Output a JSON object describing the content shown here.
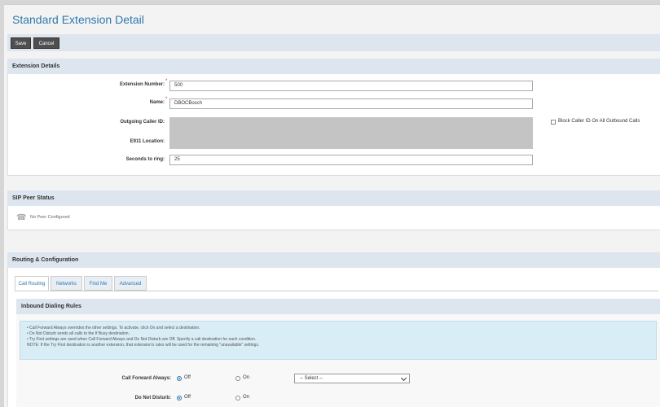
{
  "page": {
    "title": "Standard Extension Detail"
  },
  "toolbar": {
    "save_label": "Save",
    "cancel_label": "Cancel"
  },
  "extension_details": {
    "header": "Extension Details",
    "extension_number_label": "Extension Number:",
    "extension_number_value": "500",
    "name_label": "Name:",
    "name_value": "DBOCBosch",
    "outgoing_caller_id_label": "Outgoing Caller ID:",
    "e911_location_label": "E911 Location:",
    "seconds_to_ring_label": "Seconds to ring:",
    "seconds_to_ring_value": "25",
    "block_caller_id_label": "Block Caller ID On All Outbound Calls"
  },
  "sip_peer": {
    "header": "SIP Peer Status",
    "status_text": "No Peer Configured"
  },
  "routing": {
    "header": "Routing & Configuration",
    "tabs": [
      {
        "label": "Call Routing"
      },
      {
        "label": "Networks"
      },
      {
        "label": "Find Me"
      },
      {
        "label": "Advanced"
      }
    ],
    "inbound_header": "Inbound Dialing Rules",
    "info_lines": [
      "• Call Forward Always overrides the other settings. To activate, click On and select a destination.",
      "• Do Not Disturb sends all calls to the If Busy destination.",
      "• Try First settings are used when Call Forward Always and Do Not Disturb are Off. Specify a call destination for each condition.",
      "NOTE: If the Try First destination is another extension, that extension's rules will be used for the remaining \"unavailable\" settings."
    ],
    "call_forward_label": "Call Forward Always:",
    "do_not_disturb_label": "Do Not Disturb:",
    "off_label": "Off",
    "on_label": "On",
    "select_placeholder": "-- Select --"
  },
  "colors": {
    "accent": "#2f78ad",
    "section_bg": "#dde5ee",
    "info_bg": "#d9edf7"
  }
}
